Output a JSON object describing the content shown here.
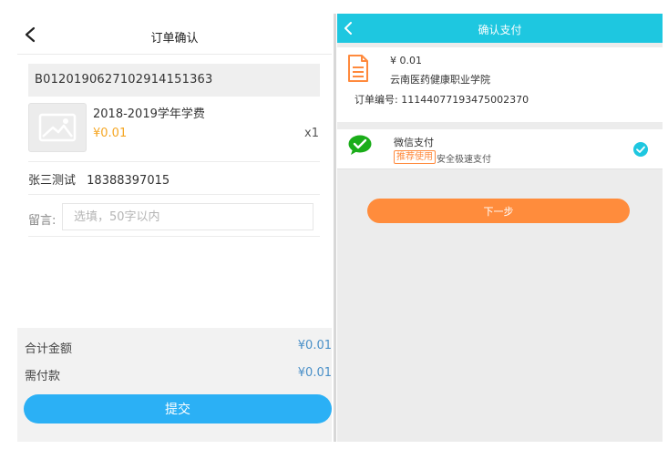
{
  "left": {
    "header": {
      "title": "订单确认"
    },
    "order": {
      "number": "B0120190627102914151363",
      "product_name": "2018-2019学年学费",
      "price": "¥0.01",
      "quantity": "x1"
    },
    "contact": {
      "name": "张三测试",
      "phone": "18388397015"
    },
    "remark": {
      "label": "留言:",
      "placeholder": "选填，50字以内"
    },
    "summary": {
      "total_label": "合计金额",
      "total_value": "¥0.01",
      "due_label": "需付款",
      "due_value": "¥0.01"
    },
    "submit_label": "提交",
    "colors": {
      "price": "#f5a623",
      "summary_value": "#4a90c8",
      "submit_button": "#2bb0f5"
    }
  },
  "right": {
    "header": {
      "title": "确认支付"
    },
    "order": {
      "amount": "¥ 0.01",
      "school": "云南医药健康职业学院",
      "code": "订单编号: 11144077193475002370"
    },
    "payment": {
      "method": "微信支付",
      "badge": "推荐使用",
      "desc": "安全极速支付",
      "selected": true
    },
    "next_label": "下一步",
    "colors": {
      "header": "#1ec7e0",
      "next_button": "#ff8c3c",
      "wechat": "#1aad19",
      "check": "#1ec7e0"
    }
  },
  "icons": [
    "chevron-left-icon",
    "image-placeholder-icon",
    "document-icon",
    "wechat-icon",
    "check-circle-icon"
  ]
}
